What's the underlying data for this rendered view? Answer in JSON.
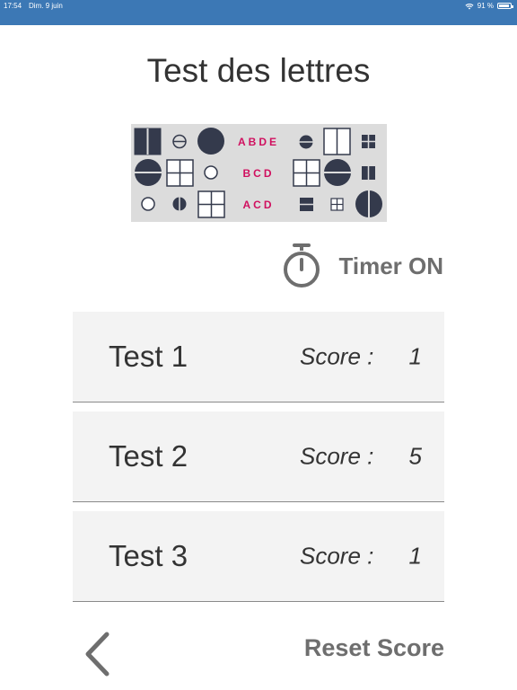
{
  "status_bar": {
    "time": "17:54",
    "date": "Dim. 9 juin",
    "battery": "91 %",
    "battery_level": 0.91,
    "background": "#3c78b5"
  },
  "page": {
    "title": "Test des lettres"
  },
  "pattern": {
    "row_labels": [
      "ABDE",
      "BCD",
      "ACD"
    ],
    "label_color": "#d0105f",
    "shape_color": "#343a4c",
    "background": "#dcdcdc"
  },
  "timer": {
    "icon": "stopwatch-icon",
    "label": "Timer ON"
  },
  "tests": [
    {
      "name": "Test 1",
      "score_label": "Score :",
      "score": "1"
    },
    {
      "name": "Test 2",
      "score_label": "Score :",
      "score": "5"
    },
    {
      "name": "Test 3",
      "score_label": "Score :",
      "score": "1"
    }
  ],
  "footer": {
    "back_icon": "chevron-left-icon",
    "reset_label": "Reset Score"
  }
}
